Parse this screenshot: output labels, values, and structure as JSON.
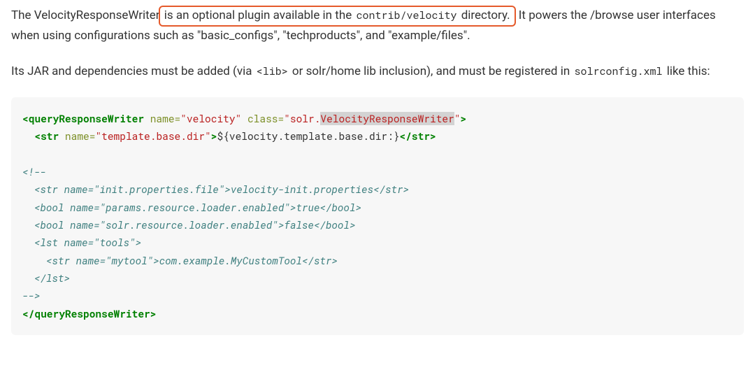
{
  "para1": {
    "t1": "The VelocityResponseWriter",
    "t2": " is an optional plugin available in the ",
    "c1": "contrib/velocity",
    "t3": " directory.",
    "t4": " It powers the /browse user interfaces when using configurations such as \"basic_configs\", \"techproducts\", and \"example/files\"."
  },
  "para2": {
    "t1": "Its JAR and dependencies must be added (via ",
    "c1": "<lib>",
    "t2": " or solr/home lib inclusion), and must be registered in ",
    "c2": "solrconfig.xml",
    "t3": " like this:"
  },
  "code": {
    "l1_open": "<queryResponseWriter",
    "l1_attr1_name": " name=",
    "l1_attr1_val": "\"velocity\"",
    "l1_attr2_name": " class=",
    "l1_attr2_val_a": "\"solr.",
    "l1_attr2_val_b": "VelocityResponseWriter",
    "l1_attr2_val_c": "\"",
    "l1_close": ">",
    "l2_indent": "  ",
    "l2_open": "<str",
    "l2_attr_name": " name=",
    "l2_attr_val": "\"template.base.dir\"",
    "l2_gt": ">",
    "l2_text": "${velocity.template.base.dir:}",
    "l2_close": "</str>",
    "c_open": "<!--",
    "c1": "  <str name=\"init.properties.file\">velocity-init.properties</str>",
    "c2": "  <bool name=\"params.resource.loader.enabled\">true</bool>",
    "c3": "  <bool name=\"solr.resource.loader.enabled\">false</bool>",
    "c4": "  <lst name=\"tools\">",
    "c5": "    <str name=\"mytool\">com.example.MyCustomTool</str>",
    "c6": "  </lst>",
    "c_close": "-->",
    "l_end": "</queryResponseWriter>"
  }
}
